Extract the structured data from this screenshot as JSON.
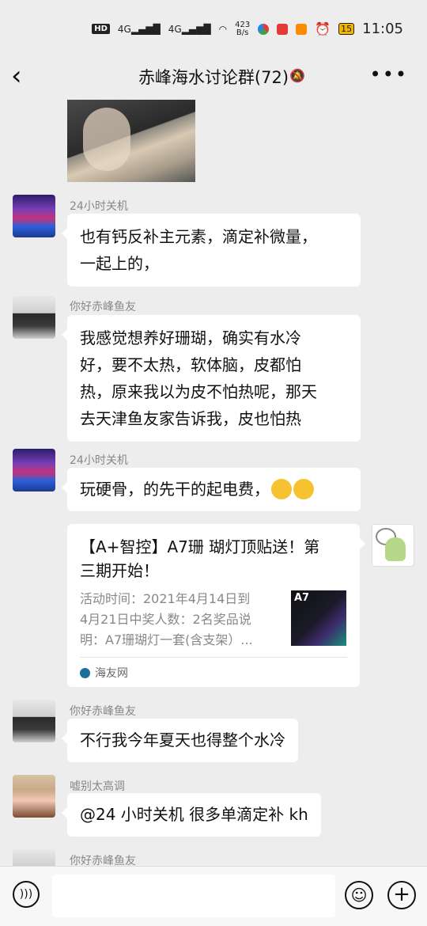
{
  "status_bar": {
    "hd": "HD",
    "signal1": "4G",
    "signal2": "4G",
    "speed_value": "423",
    "speed_unit": "B/s",
    "battery": "15",
    "time": "11:05"
  },
  "header": {
    "back_icon": "chevron-left-icon",
    "title": "赤峰海水讨论群(72)",
    "mute_icon": "bell-off-icon",
    "more_icon": "more-dots-icon"
  },
  "messages": [
    {
      "sender": "24小时关机",
      "lines": [
        "也有钙反补主元素，滴定补微量，",
        "一起上的，"
      ]
    },
    {
      "sender": "你好赤峰鱼友",
      "lines": [
        "我感觉想养好珊瑚，确实有水冷",
        "好，要不太热，软体脑，皮都怕",
        "热，原来我以为皮不怕热呢，那天",
        "去天津鱼友家告诉我，皮也怕热"
      ]
    },
    {
      "sender": "24小时关机",
      "text": "玩硬骨，的先干的起电费，"
    },
    {
      "sender": "你好赤峰鱼友",
      "text": "不行我今年夏天也得整个水冷"
    },
    {
      "sender": "嘘别太高调",
      "text": "@24 小时关机  很多单滴定补 kh"
    },
    {
      "sender": "你好赤峰鱼友"
    }
  ],
  "card": {
    "title_line1": "【A+智控】A7珊 瑚灯顶贴送！第",
    "title_line2": "三期开始！",
    "desc_line1": "活动时间：2021年4月14日到",
    "desc_line2": "4月21日中奖人数：2名奖品说",
    "desc_line3": "明：A7珊瑚灯一套(含支架）...",
    "thumb_label": "A7",
    "source": "海友网"
  },
  "input_bar": {
    "voice_icon": "voice-icon",
    "emoji_icon": "emoji-icon",
    "plus_icon": "plus-icon"
  }
}
